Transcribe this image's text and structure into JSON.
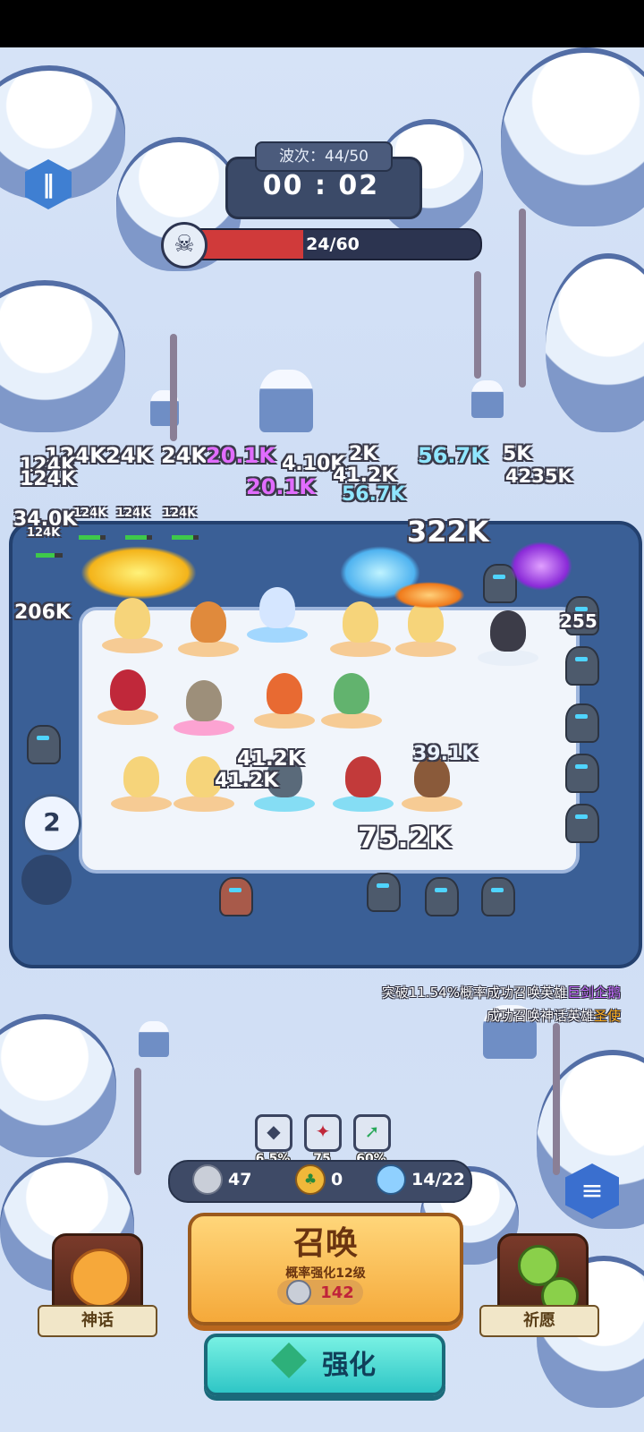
{
  "wave": {
    "label": "波次：44/50",
    "timer": "00 : 02"
  },
  "enemies": {
    "count": "24/60",
    "fraction": 0.4
  },
  "damage_numbers": [
    "124K",
    "124K",
    "124K",
    "24K",
    "24K",
    "20.1K",
    "4.10K",
    "2K",
    "56.7K",
    "5K",
    "20.1K",
    "41.2K",
    "56.7K",
    "4235K",
    "322K",
    "34.0K",
    "124K",
    "124K",
    "124K",
    "124K",
    "206K",
    "255",
    "41.2K",
    "39.1K",
    "41.2K",
    "75.2K"
  ],
  "level_badge": "2",
  "messages": {
    "line1_prefix": "突破11.54%概率成功召唤英雄",
    "line1_hero": "巨剑企鹅",
    "line2_prefix": "成功召唤神话英雄",
    "line2_hero": "圣使"
  },
  "stats": [
    {
      "icon": "crit-icon",
      "value": "6.5%"
    },
    {
      "icon": "attack-icon",
      "value": "75"
    },
    {
      "icon": "speed-icon",
      "value": "60%"
    }
  ],
  "resources": {
    "silver": "47",
    "clover": "0",
    "population": "14/22"
  },
  "summon": {
    "title": "召唤",
    "subtitle": "概率强化12级",
    "cost": "142"
  },
  "upgrade": {
    "label": "强化"
  },
  "side_buttons": {
    "mythic": "神话",
    "wish": "祈愿"
  }
}
